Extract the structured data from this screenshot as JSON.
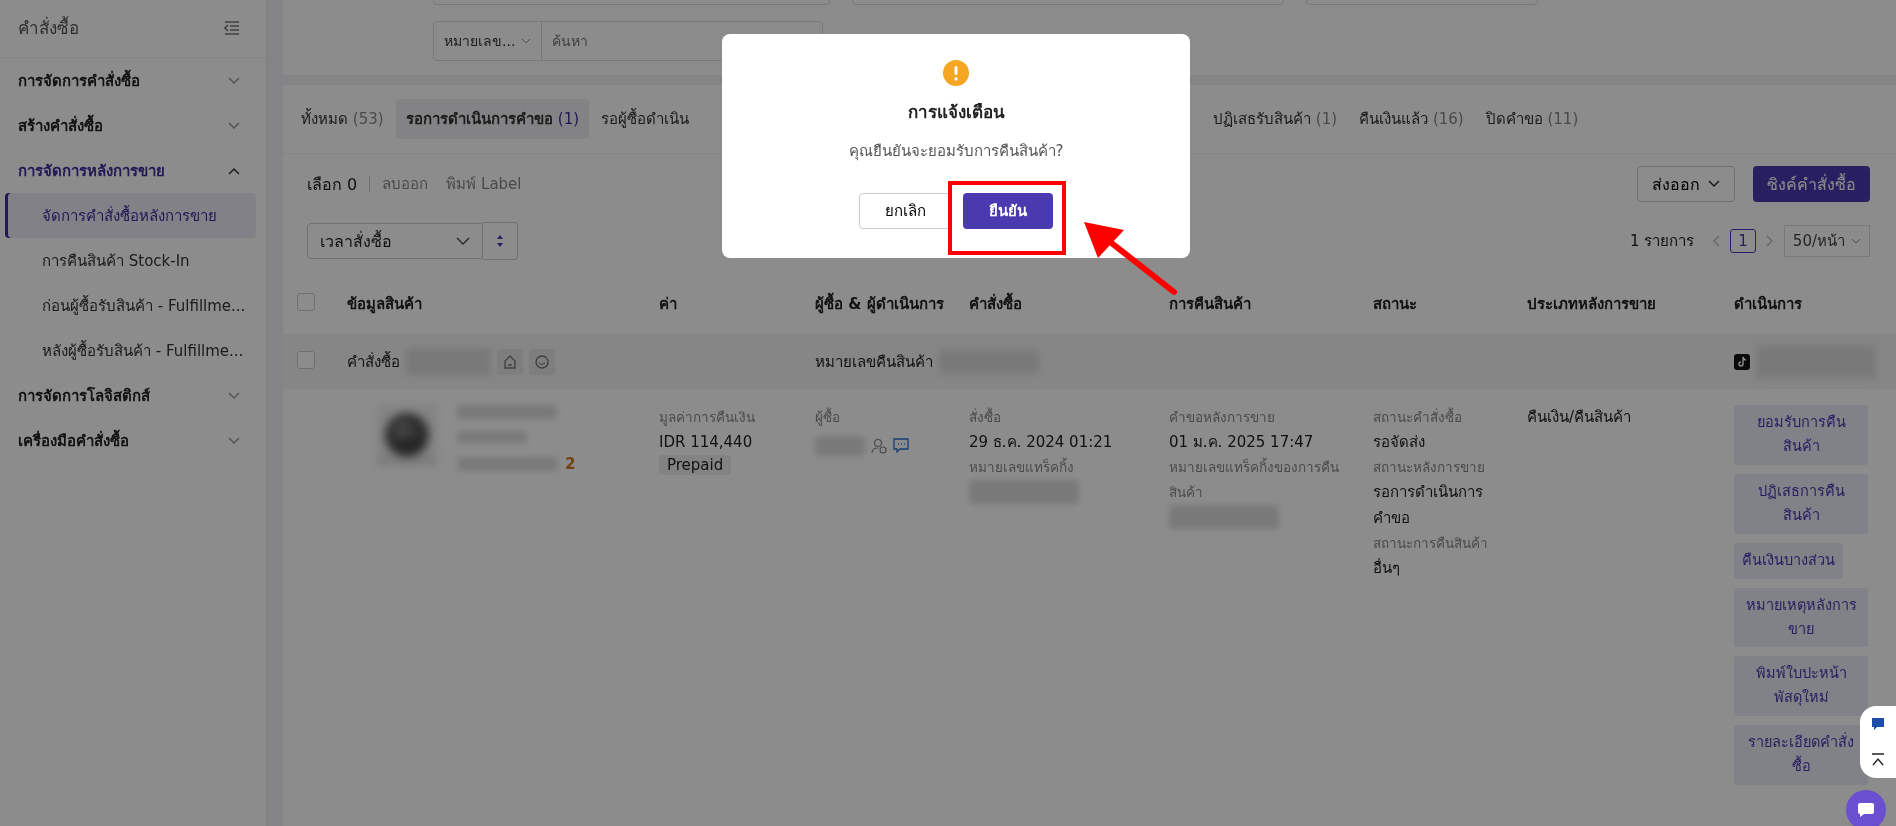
{
  "sidebar": {
    "title": "คำสั่งซื้อ",
    "items": [
      {
        "label": "การจัดการคำสั่งซื้อ",
        "expanded": false
      },
      {
        "label": "สร้างคำสั่งซื้อ",
        "expanded": false
      },
      {
        "label": "การจัดการหลังการขาย",
        "expanded": true,
        "children": [
          {
            "label": "จัดการคำสั่งซื้อหลังการขาย",
            "selected": true
          },
          {
            "label": "การคืนสินค้า Stock-In",
            "selected": false
          },
          {
            "label": "ก่อนผู้ซื้อรับสินค้า - Fulfillme...",
            "selected": false
          },
          {
            "label": "หลังผู้ซื้อรับสินค้า - Fulfillme...",
            "selected": false
          }
        ]
      },
      {
        "label": "การจัดการโลจิสติกส์",
        "expanded": false
      },
      {
        "label": "เครื่องมือคำสั่งซื้อ",
        "expanded": false
      }
    ]
  },
  "filter": {
    "search_type": "หมายเลข...",
    "search": {
      "placeholder": "ค้นหา"
    }
  },
  "tabs": [
    {
      "label": "ทั้งหมด",
      "count": "(53)",
      "selected": false
    },
    {
      "label": "รอการดำเนินการคำขอ",
      "count": "(1)",
      "selected": true
    },
    {
      "label": "รอผู้ซื้อดำเนิน",
      "selected": false
    },
    {
      "label": "ปฏิเสธรับสินค้า",
      "count": "(1)",
      "selected": false
    },
    {
      "label": "คืนเงินแล้ว",
      "count": "(16)",
      "selected": false
    },
    {
      "label": "ปิดคำขอ",
      "count": "(11)",
      "selected": false
    }
  ],
  "toolbar": {
    "selected": "เลือก 0",
    "actions": [
      "ลบออก",
      "พิมพ์ Label"
    ],
    "export": "ส่งออก",
    "sync": "ซิงค์คำสั่งซื้อ"
  },
  "sort": {
    "field": "เวลาสั่งซื้อ"
  },
  "pagination": {
    "total": "1 รายการ",
    "page": "1",
    "page_size": "50/หน้า"
  },
  "table": {
    "header_checkbox": {
      "checked": false
    },
    "columns": [
      "ข้อมูลสินค้า",
      "ค่า",
      "ผู้ซื้อ & ผู้ดำเนินการ",
      "คำสั่งซื้อ",
      "การคืนสินค้า",
      "สถานะ",
      "ประเภทหลังการขาย",
      "ดำเนินการ"
    ],
    "group": {
      "checked": false,
      "order_label": "คำสั่งซื้อ",
      "return_label": "หมายเลขคืนสินค้า"
    },
    "row": {
      "quantity": "2",
      "amount_label": "มูลค่าการคืนเงิน",
      "amount": "IDR 114,440",
      "payment": "Prepaid",
      "buyer_label": "ผู้ซื้อ",
      "order_label": "สั่งซื้อ",
      "order_date": "29 ธ.ค. 2024 01:21",
      "order_tracking_label": "หมายเลขแทร็คกิ้ง",
      "request_label": "คำขอหลังการขาย",
      "request_date": "01 ม.ค. 2025 17:47",
      "return_tracking_label": "หมายเลขแทร็คกิ้งของการคืนสินค้า",
      "statuses": [
        {
          "label": "สถานะคำสั่งซื้อ",
          "value": "รอจัดส่ง"
        },
        {
          "label": "สถานะหลังการขาย",
          "value": "รอการดำเนินการคำขอ"
        },
        {
          "label": "สถานะการคืนสินค้า",
          "value": "อื่นๆ"
        }
      ],
      "type": "คืนเงิน/คืนสินค้า",
      "actions": [
        "ยอมรับการคืนสินค้า",
        "ปฏิเสธการคืนสินค้า",
        "คืนเงินบางส่วน",
        "หมายเหตุหลังการขาย",
        "พิมพ์ใบปะหน้าพัสดุใหม่",
        "รายละเอียดคำสั่งซื้อ"
      ]
    }
  },
  "dialog": {
    "title": "การแจ้งเตือน",
    "message": "คุณยืนยันจะยอมรับการคืนสินค้า?",
    "cancel": "ยกเลิก",
    "confirm": "ยืนยัน"
  }
}
